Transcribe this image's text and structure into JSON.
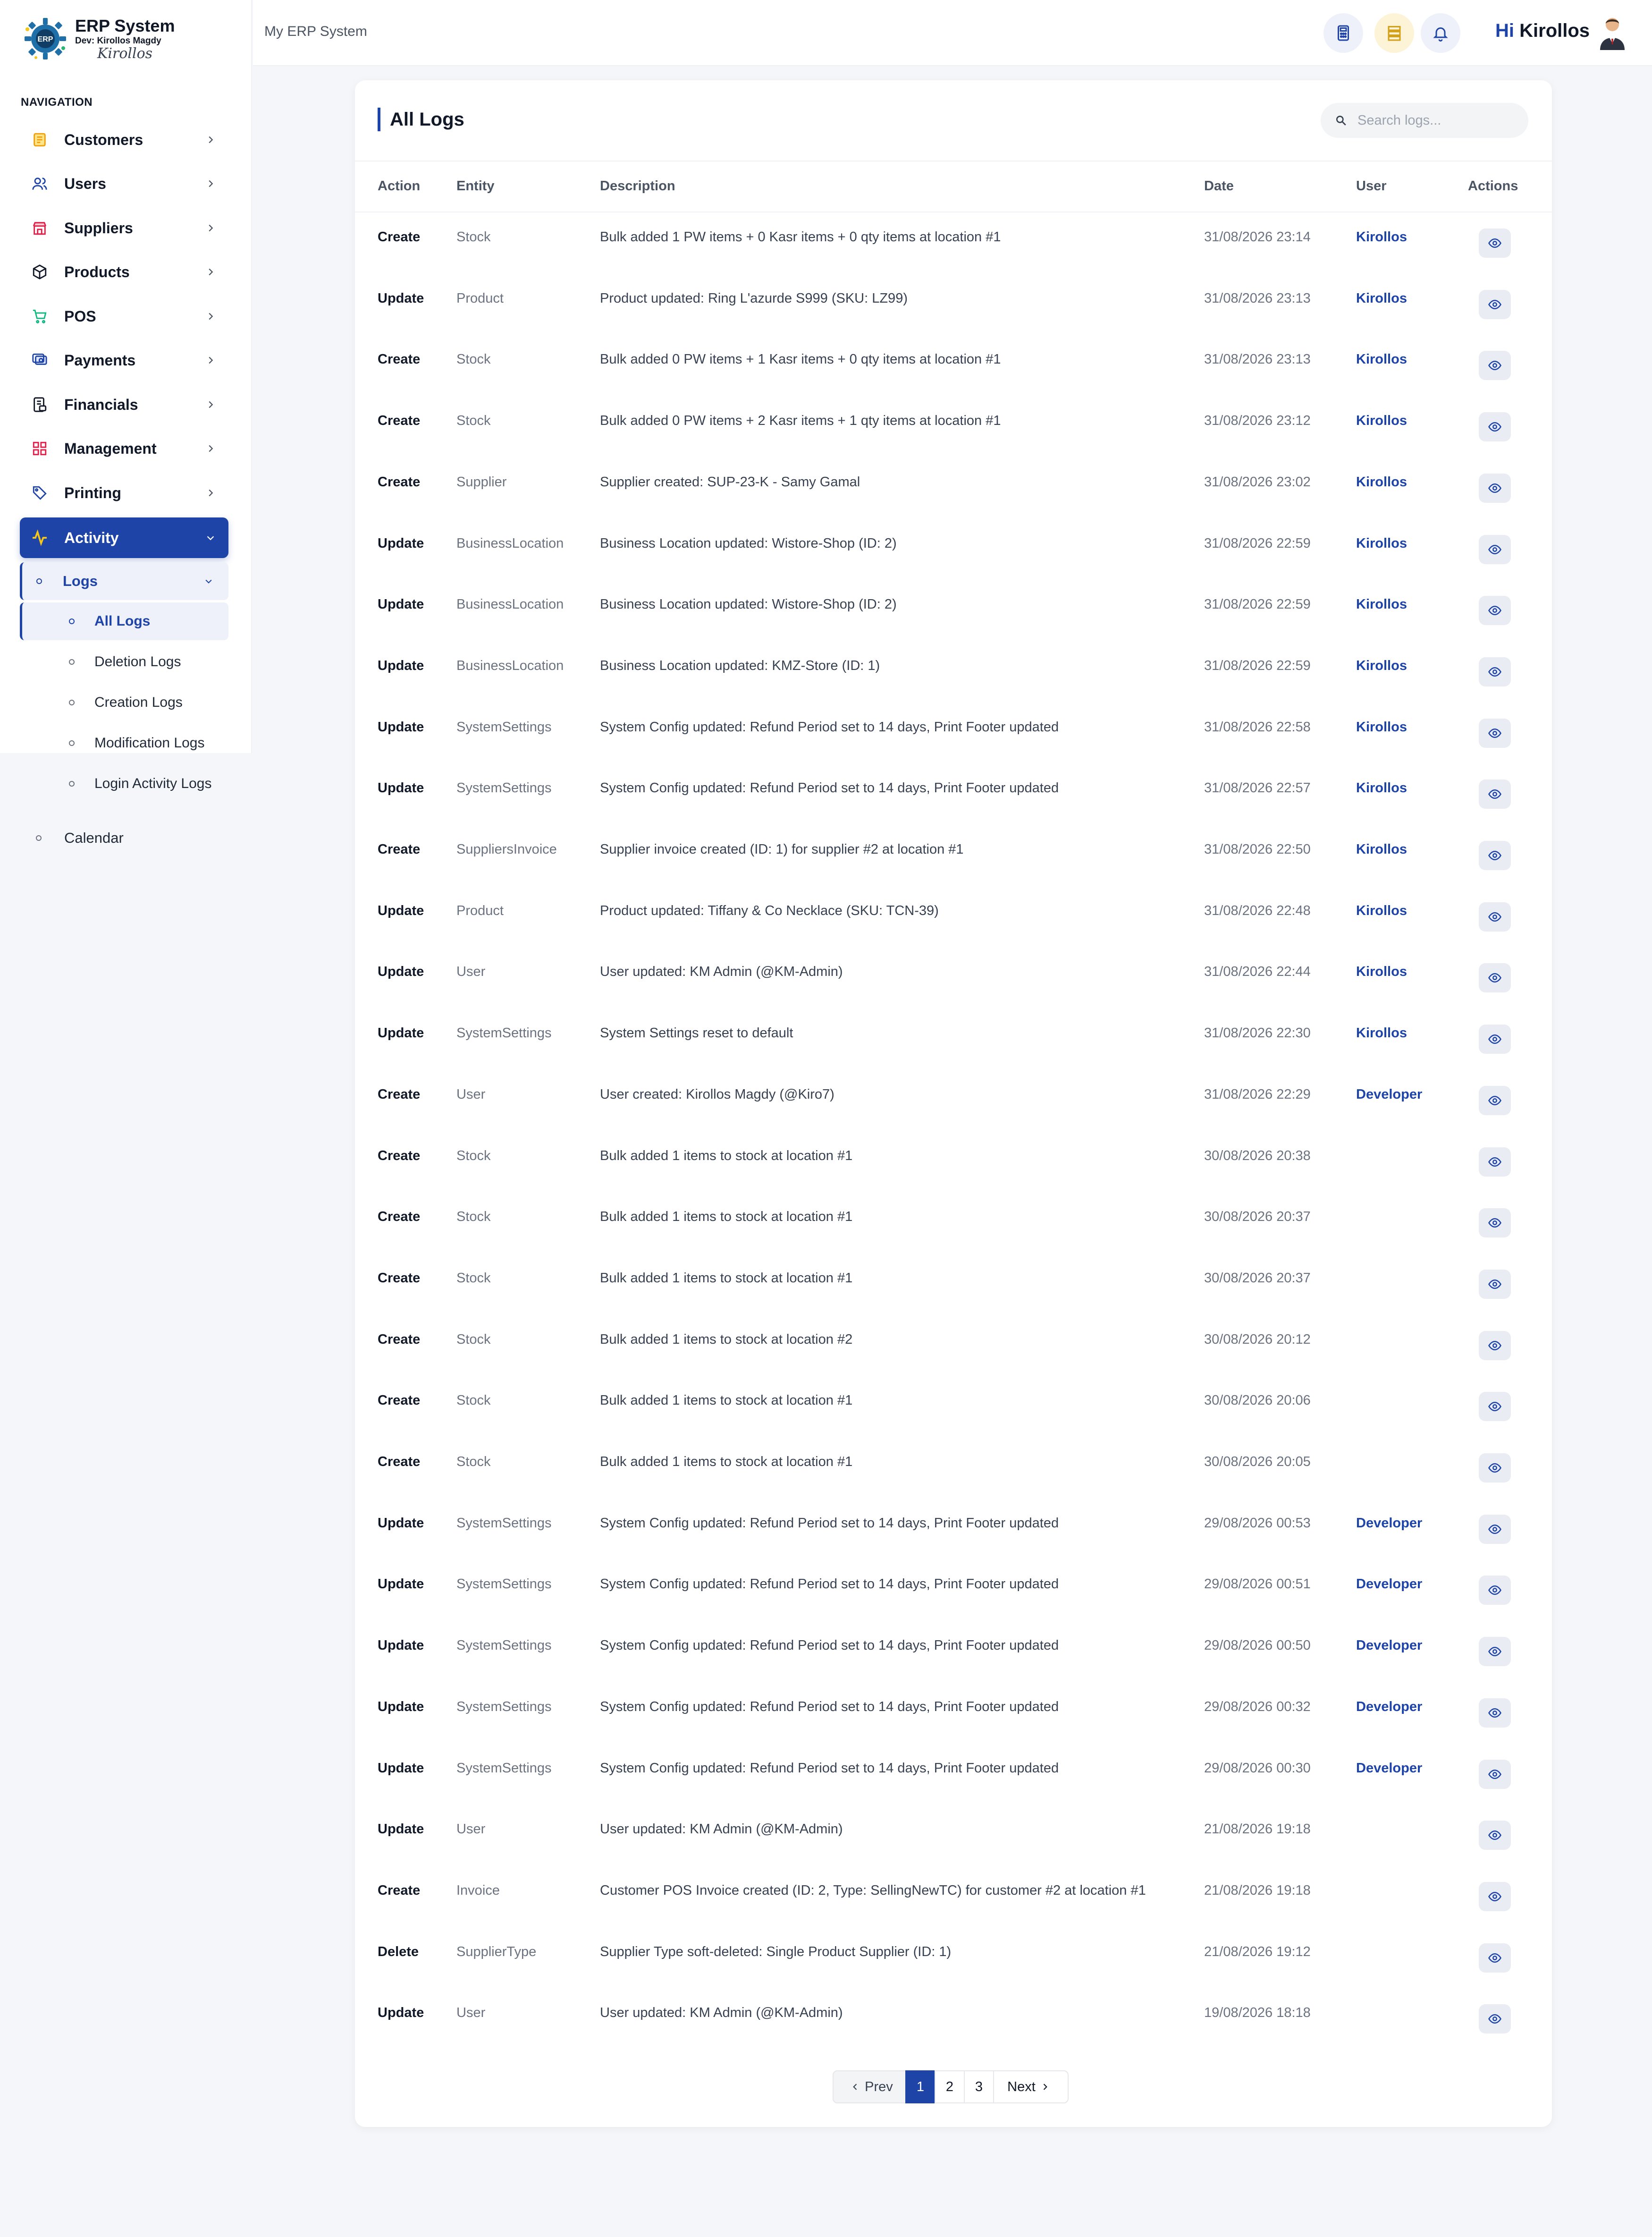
{
  "brand": {
    "logo_text": "ERP",
    "title": "ERP System",
    "dev": "Dev: Kirollos Magdy",
    "signature": "Kirollos"
  },
  "nav": {
    "heading": "NAVIGATION",
    "items": [
      {
        "label": "Customers",
        "icon": "customers-icon",
        "color": "#f59e0b"
      },
      {
        "label": "Users",
        "icon": "users-icon",
        "color": "#1e44a8"
      },
      {
        "label": "Suppliers",
        "icon": "suppliers-icon",
        "color": "#e11d48"
      },
      {
        "label": "Products",
        "icon": "products-icon",
        "color": "#111827"
      },
      {
        "label": "POS",
        "icon": "pos-icon",
        "color": "#10b981"
      },
      {
        "label": "Payments",
        "icon": "payments-icon",
        "color": "#1e44a8"
      },
      {
        "label": "Financials",
        "icon": "financials-icon",
        "color": "#111827"
      },
      {
        "label": "Management",
        "icon": "management-icon",
        "color": "#e11d48"
      },
      {
        "label": "Printing",
        "icon": "printing-icon",
        "color": "#1e44a8"
      },
      {
        "label": "Activity",
        "icon": "activity-icon",
        "color": "#f5c518"
      }
    ],
    "logs_label": "Logs",
    "log_items": [
      "All Logs",
      "Deletion Logs",
      "Creation Logs",
      "Modification Logs",
      "Login Activity Logs"
    ],
    "calendar_label": "Calendar"
  },
  "header": {
    "breadcrumb": "My ERP System",
    "greeting_hi": "Hi",
    "greeting_name": "Kirollos"
  },
  "page": {
    "title": "All Logs",
    "search_placeholder": "Search logs..."
  },
  "table": {
    "columns": [
      "Action",
      "Entity",
      "Description",
      "Date",
      "User",
      "Actions"
    ],
    "rows": [
      {
        "action": "Create",
        "entity": "Stock",
        "description": "Bulk added 1 PW items + 0 Kasr items + 0 qty items at location #1",
        "date": "31/08/2026 23:14",
        "user": "Kirollos"
      },
      {
        "action": "Update",
        "entity": "Product",
        "description": "Product updated: Ring L'azurde S999 (SKU: LZ99)",
        "date": "31/08/2026 23:13",
        "user": "Kirollos"
      },
      {
        "action": "Create",
        "entity": "Stock",
        "description": "Bulk added 0 PW items + 1 Kasr items + 0 qty items at location #1",
        "date": "31/08/2026 23:13",
        "user": "Kirollos"
      },
      {
        "action": "Create",
        "entity": "Stock",
        "description": "Bulk added 0 PW items + 2 Kasr items + 1 qty items at location #1",
        "date": "31/08/2026 23:12",
        "user": "Kirollos"
      },
      {
        "action": "Create",
        "entity": "Supplier",
        "description": "Supplier created: SUP-23-K - Samy Gamal",
        "date": "31/08/2026 23:02",
        "user": "Kirollos"
      },
      {
        "action": "Update",
        "entity": "BusinessLocation",
        "description": "Business Location updated: Wistore-Shop (ID: 2)",
        "date": "31/08/2026 22:59",
        "user": "Kirollos"
      },
      {
        "action": "Update",
        "entity": "BusinessLocation",
        "description": "Business Location updated: Wistore-Shop (ID: 2)",
        "date": "31/08/2026 22:59",
        "user": "Kirollos"
      },
      {
        "action": "Update",
        "entity": "BusinessLocation",
        "description": "Business Location updated: KMZ-Store (ID: 1)",
        "date": "31/08/2026 22:59",
        "user": "Kirollos"
      },
      {
        "action": "Update",
        "entity": "SystemSettings",
        "description": "System Config updated: Refund Period set to 14 days, Print Footer updated",
        "date": "31/08/2026 22:58",
        "user": "Kirollos"
      },
      {
        "action": "Update",
        "entity": "SystemSettings",
        "description": "System Config updated: Refund Period set to 14 days, Print Footer updated",
        "date": "31/08/2026 22:57",
        "user": "Kirollos"
      },
      {
        "action": "Create",
        "entity": "SuppliersInvoice",
        "description": "Supplier invoice created (ID: 1) for supplier #2 at location #1",
        "date": "31/08/2026 22:50",
        "user": "Kirollos"
      },
      {
        "action": "Update",
        "entity": "Product",
        "description": "Product updated: Tiffany & Co Necklace (SKU: TCN-39)",
        "date": "31/08/2026 22:48",
        "user": "Kirollos"
      },
      {
        "action": "Update",
        "entity": "User",
        "description": "User updated: KM Admin (@KM-Admin)",
        "date": "31/08/2026 22:44",
        "user": "Kirollos"
      },
      {
        "action": "Update",
        "entity": "SystemSettings",
        "description": "System Settings reset to default",
        "date": "31/08/2026 22:30",
        "user": "Kirollos"
      },
      {
        "action": "Create",
        "entity": "User",
        "description": "User created: Kirollos Magdy (@Kiro7)",
        "date": "31/08/2026 22:29",
        "user": "Developer"
      },
      {
        "action": "Create",
        "entity": "Stock",
        "description": "Bulk added 1 items to stock at location #1",
        "date": "30/08/2026 20:38",
        "user": ""
      },
      {
        "action": "Create",
        "entity": "Stock",
        "description": "Bulk added 1 items to stock at location #1",
        "date": "30/08/2026 20:37",
        "user": ""
      },
      {
        "action": "Create",
        "entity": "Stock",
        "description": "Bulk added 1 items to stock at location #1",
        "date": "30/08/2026 20:37",
        "user": ""
      },
      {
        "action": "Create",
        "entity": "Stock",
        "description": "Bulk added 1 items to stock at location #2",
        "date": "30/08/2026 20:12",
        "user": ""
      },
      {
        "action": "Create",
        "entity": "Stock",
        "description": "Bulk added 1 items to stock at location #1",
        "date": "30/08/2026 20:06",
        "user": ""
      },
      {
        "action": "Create",
        "entity": "Stock",
        "description": "Bulk added 1 items to stock at location #1",
        "date": "30/08/2026 20:05",
        "user": ""
      },
      {
        "action": "Update",
        "entity": "SystemSettings",
        "description": "System Config updated: Refund Period set to 14 days, Print Footer updated",
        "date": "29/08/2026 00:53",
        "user": "Developer"
      },
      {
        "action": "Update",
        "entity": "SystemSettings",
        "description": "System Config updated: Refund Period set to 14 days, Print Footer updated",
        "date": "29/08/2026 00:51",
        "user": "Developer"
      },
      {
        "action": "Update",
        "entity": "SystemSettings",
        "description": "System Config updated: Refund Period set to 14 days, Print Footer updated",
        "date": "29/08/2026 00:50",
        "user": "Developer"
      },
      {
        "action": "Update",
        "entity": "SystemSettings",
        "description": "System Config updated: Refund Period set to 14 days, Print Footer updated",
        "date": "29/08/2026 00:32",
        "user": "Developer"
      },
      {
        "action": "Update",
        "entity": "SystemSettings",
        "description": "System Config updated: Refund Period set to 14 days, Print Footer updated",
        "date": "29/08/2026 00:30",
        "user": "Developer"
      },
      {
        "action": "Update",
        "entity": "User",
        "description": "User updated: KM Admin (@KM-Admin)",
        "date": "21/08/2026 19:18",
        "user": ""
      },
      {
        "action": "Create",
        "entity": "Invoice",
        "description": "Customer POS Invoice created (ID: 2, Type: SellingNewTC) for customer #2 at location #1",
        "date": "21/08/2026 19:18",
        "user": ""
      },
      {
        "action": "Delete",
        "entity": "SupplierType",
        "description": "Supplier Type soft-deleted: Single Product Supplier (ID: 1)",
        "date": "21/08/2026 19:12",
        "user": ""
      },
      {
        "action": "Update",
        "entity": "User",
        "description": "User updated: KM Admin (@KM-Admin)",
        "date": "19/08/2026 18:18",
        "user": ""
      }
    ]
  },
  "pagination": {
    "prev": "Prev",
    "pages": [
      "1",
      "2",
      "3"
    ],
    "current": "1",
    "next": "Next"
  },
  "colors": {
    "primary": "#1e44a8",
    "accent": "#f5c518",
    "header_icon_bg_blue": "#eef1fa",
    "header_icon_bg_yellow": "#fdf3d6"
  }
}
